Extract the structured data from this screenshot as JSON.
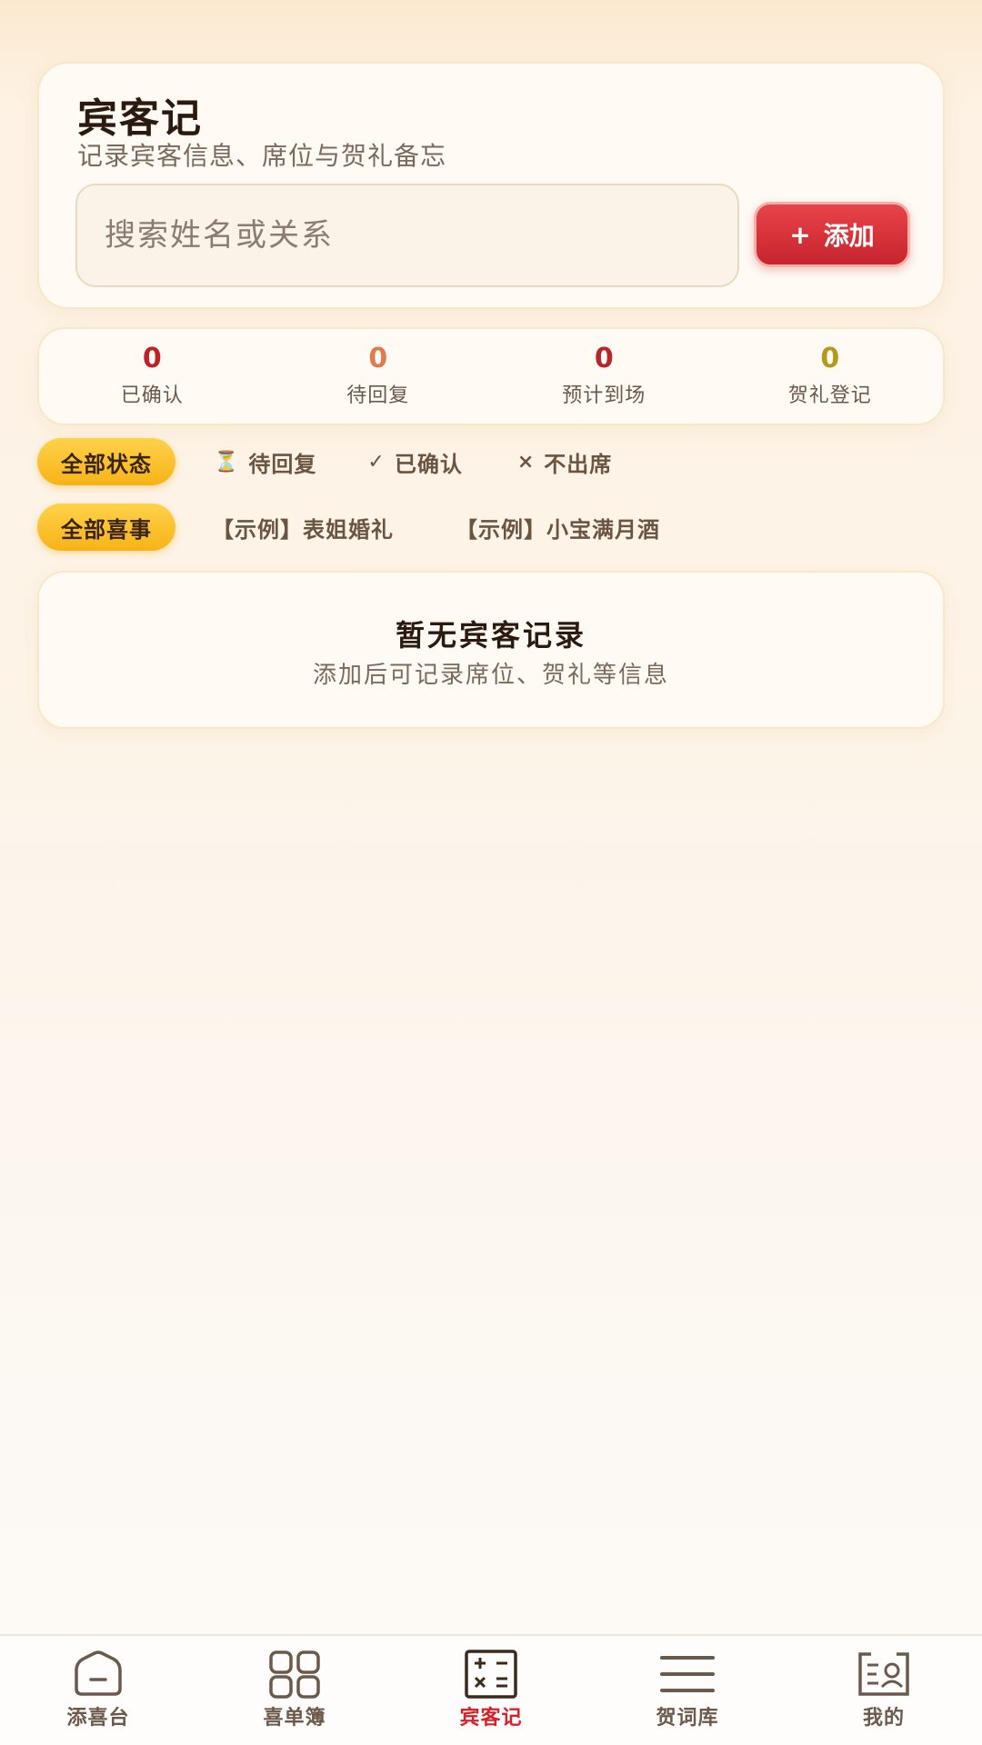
{
  "header": {
    "title": "宾客记",
    "subtitle": "记录宾客信息、席位与贺礼备忘",
    "search_placeholder": "搜索姓名或关系",
    "search_value": "",
    "add_label": "添加",
    "add_icon": "+"
  },
  "stats": [
    {
      "value": "0",
      "label": "已确认",
      "color": "#b8242a"
    },
    {
      "value": "0",
      "label": "待回复",
      "color": "#e07b4a"
    },
    {
      "value": "0",
      "label": "预计到场",
      "color": "#b8242a"
    },
    {
      "value": "0",
      "label": "贺礼登记",
      "color": "#b59a1a"
    }
  ],
  "status_filter": {
    "active": "全部状态",
    "options": [
      {
        "icon": "⏳",
        "label": "待回复"
      },
      {
        "icon": "✓",
        "label": "已确认"
      },
      {
        "icon": "×",
        "label": "不出席"
      }
    ]
  },
  "event_filter": {
    "active": "全部喜事",
    "options": [
      {
        "label": "【示例】表姐婚礼"
      },
      {
        "label": "【示例】小宝满月酒"
      }
    ]
  },
  "empty_state": {
    "title": "暂无宾客记录",
    "subtitle": "添加后可记录席位、贺礼等信息"
  },
  "nav": [
    {
      "label": "添喜台",
      "icon": "home-icon",
      "active": false
    },
    {
      "label": "喜单簿",
      "icon": "grid-icon",
      "active": false
    },
    {
      "label": "宾客记",
      "icon": "calculator-icon",
      "active": true
    },
    {
      "label": "贺词库",
      "icon": "menu-lines-icon",
      "active": false
    },
    {
      "label": "我的",
      "icon": "profile-card-icon",
      "active": false
    }
  ],
  "colors": {
    "accent_red": "#d5212a",
    "chip_yellow": "#f7b317"
  }
}
